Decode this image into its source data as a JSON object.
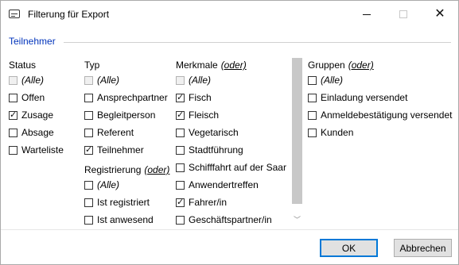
{
  "window": {
    "title": "Filterung für Export"
  },
  "group": {
    "title": "Teilnehmer"
  },
  "status": {
    "header": "Status",
    "items": [
      {
        "label": "(Alle)",
        "checked": false,
        "disabled": true,
        "italic": true
      },
      {
        "label": "Offen",
        "checked": false
      },
      {
        "label": "Zusage",
        "checked": true
      },
      {
        "label": "Absage",
        "checked": false
      },
      {
        "label": "Warteliste",
        "checked": false
      }
    ]
  },
  "typ": {
    "header": "Typ",
    "items": [
      {
        "label": "(Alle)",
        "checked": false,
        "disabled": true,
        "italic": true
      },
      {
        "label": "Ansprechpartner",
        "checked": false
      },
      {
        "label": "Begleitperson",
        "checked": false
      },
      {
        "label": "Referent",
        "checked": false
      },
      {
        "label": "Teilnehmer",
        "checked": true
      }
    ]
  },
  "registrierung": {
    "header": "Registrierung",
    "oder": "(oder)",
    "items": [
      {
        "label": "(Alle)",
        "checked": false,
        "italic": true
      },
      {
        "label": "Ist registriert",
        "checked": false
      },
      {
        "label": "Ist anwesend",
        "checked": false
      }
    ]
  },
  "merkmale": {
    "header": "Merkmale",
    "oder": "(oder)",
    "items": [
      {
        "label": "(Alle)",
        "checked": false,
        "disabled": true,
        "italic": true
      },
      {
        "label": "Fisch",
        "checked": true
      },
      {
        "label": "Fleisch",
        "checked": true
      },
      {
        "label": "Vegetarisch",
        "checked": false
      },
      {
        "label": "Stadtführung",
        "checked": false
      },
      {
        "label": "Schifffahrt auf der Saar",
        "checked": false
      },
      {
        "label": "Anwendertreffen",
        "checked": false
      },
      {
        "label": "Fahrer/in",
        "checked": true
      },
      {
        "label": "Geschäftspartner/in",
        "checked": false
      }
    ]
  },
  "gruppen": {
    "header": "Gruppen",
    "oder": "(oder)",
    "items": [
      {
        "label": "(Alle)",
        "checked": false,
        "italic": true
      },
      {
        "label": "Einladung versendet",
        "checked": false
      },
      {
        "label": "Anmeldebestätigung versendet",
        "checked": false
      },
      {
        "label": "Kunden",
        "checked": false
      }
    ]
  },
  "buttons": {
    "ok": "OK",
    "cancel": "Abbrechen"
  },
  "icons": {
    "app": "filter-app-icon",
    "minimize": "minimize-icon",
    "maximize": "maximize-icon",
    "close": "close-icon",
    "scroll_down": "chevron-down-icon"
  }
}
